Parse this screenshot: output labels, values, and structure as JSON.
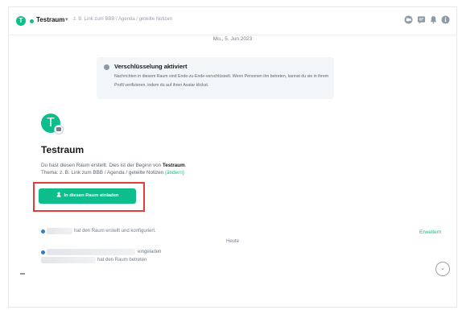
{
  "header": {
    "room_initial": "T",
    "room_name": "Testraum",
    "chevron": "▾",
    "topic": "z. B. Link zum BBB / Agenda / geteilte Notizen",
    "icons": [
      "video-icon",
      "threads-icon",
      "notifications-icon",
      "room-info-icon"
    ]
  },
  "timeline": {
    "date": "Mo., 5. Jun 2023",
    "encryption": {
      "title": "Verschlüsselung aktiviert",
      "text": "Nachrichten in diesem Raum sind Ende-zu-Ende-verschlüsselt. Wenn Personen ihn betreten, kannst du sie in ihrem Profil verifizieren, indem du auf ihren Avatar klickst."
    },
    "intro": {
      "avatar_initial": "T",
      "title": "Testraum",
      "created_prefix": "Du hast diesen Raum erstellt. Dies ist der Beginn von ",
      "room_name": "Testraum",
      "created_suffix": ".",
      "topic_prefix": "Thema: z. B. Link zum BBB / Agenda / geteilte Notizen ",
      "topic_edit": "(ändern)",
      "invite_label": "In diesen Raum einladen"
    },
    "event_created": "hat den Raum erstellt und konfiguriert.",
    "expand_label": "Erweitern",
    "today": "Heute",
    "event_invited": "eingeladen",
    "event_joined": "hat den Raum betreten",
    "scroll_down": "⌄"
  },
  "colors": {
    "accent": "#0dbd8b",
    "highlight": "#e23c3c",
    "event_dot": "#2d7dd2"
  }
}
